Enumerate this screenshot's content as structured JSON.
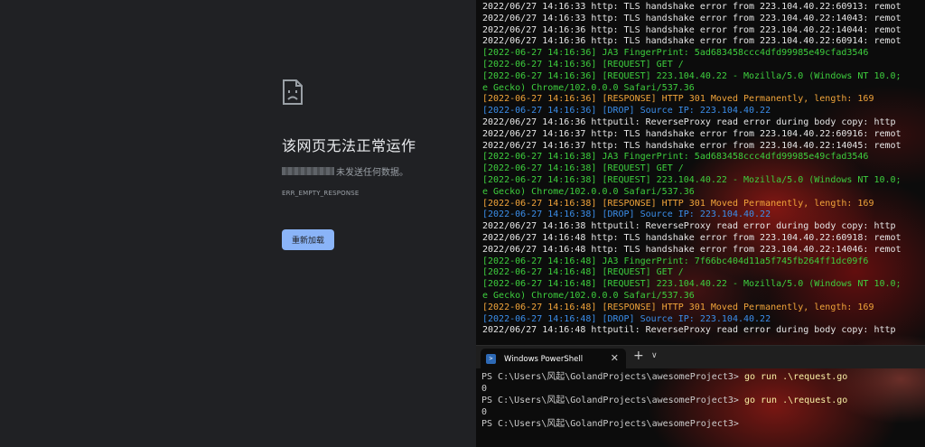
{
  "browser": {
    "error_title": "该网页无法正常运作",
    "error_desc_suffix": "未发送任何数据。",
    "error_code": "ERR_EMPTY_RESPONSE",
    "reload_label": "重新加载",
    "colors": {
      "background": "#202124",
      "button": "#8ab4f8"
    }
  },
  "terminal": {
    "log_lines": [
      {
        "color": "white",
        "text": "2022/06/27 14:16:33 http: TLS handshake error from 223.104.40.22:60913: remot"
      },
      {
        "color": "white",
        "text": "2022/06/27 14:16:33 http: TLS handshake error from 223.104.40.22:14043: remot"
      },
      {
        "color": "white",
        "text": "2022/06/27 14:16:36 http: TLS handshake error from 223.104.40.22:14044: remot"
      },
      {
        "color": "white",
        "text": "2022/06/27 14:16:36 http: TLS handshake error from 223.104.40.22:60914: remot"
      },
      {
        "color": "green",
        "text": "[2022-06-27 14:16:36] JA3 FingerPrint: 5ad683458ccc4dfd99985e49cfad3546"
      },
      {
        "color": "green",
        "text": "[2022-06-27 14:16:36] [REQUEST] GET /"
      },
      {
        "color": "green",
        "text": "[2022-06-27 14:16:36] [REQUEST] 223.104.40.22 - Mozilla/5.0 (Windows NT 10.0;"
      },
      {
        "color": "green",
        "text": "e Gecko) Chrome/102.0.0.0 Safari/537.36"
      },
      {
        "color": "orange",
        "text": "[2022-06-27 14:16:36] [RESPONSE] HTTP 301 Moved Permanently, length: 169"
      },
      {
        "color": "blue",
        "text": "[2022-06-27 14:16:36] [DROP] Source IP: 223.104.40.22"
      },
      {
        "color": "white",
        "text": "2022/06/27 14:16:36 httputil: ReverseProxy read error during body copy: http"
      },
      {
        "color": "white",
        "text": "2022/06/27 14:16:37 http: TLS handshake error from 223.104.40.22:60916: remot"
      },
      {
        "color": "white",
        "text": "2022/06/27 14:16:37 http: TLS handshake error from 223.104.40.22:14045: remot"
      },
      {
        "color": "green",
        "text": "[2022-06-27 14:16:38] JA3 FingerPrint: 5ad683458ccc4dfd99985e49cfad3546"
      },
      {
        "color": "green",
        "text": "[2022-06-27 14:16:38] [REQUEST] GET /"
      },
      {
        "color": "green",
        "text": "[2022-06-27 14:16:38] [REQUEST] 223.104.40.22 - Mozilla/5.0 (Windows NT 10.0;"
      },
      {
        "color": "green",
        "text": "e Gecko) Chrome/102.0.0.0 Safari/537.36"
      },
      {
        "color": "orange",
        "text": "[2022-06-27 14:16:38] [RESPONSE] HTTP 301 Moved Permanently, length: 169"
      },
      {
        "color": "blue",
        "text": "[2022-06-27 14:16:38] [DROP] Source IP: 223.104.40.22"
      },
      {
        "color": "white",
        "text": "2022/06/27 14:16:38 httputil: ReverseProxy read error during body copy: http"
      },
      {
        "color": "white",
        "text": "2022/06/27 14:16:48 http: TLS handshake error from 223.104.40.22:60918: remot"
      },
      {
        "color": "white",
        "text": "2022/06/27 14:16:48 http: TLS handshake error from 223.104.40.22:14046: remot"
      },
      {
        "color": "green",
        "text": "[2022-06-27 14:16:48] JA3 FingerPrint: 7f66bc404d11a5f745fb264ff1dc09f6"
      },
      {
        "color": "green",
        "text": "[2022-06-27 14:16:48] [REQUEST] GET /"
      },
      {
        "color": "green",
        "text": "[2022-06-27 14:16:48] [REQUEST] 223.104.40.22 - Mozilla/5.0 (Windows NT 10.0;"
      },
      {
        "color": "green",
        "text": "e Gecko) Chrome/102.0.0.0 Safari/537.36"
      },
      {
        "color": "orange",
        "text": "[2022-06-27 14:16:48] [RESPONSE] HTTP 301 Moved Permanently, length: 169"
      },
      {
        "color": "blue",
        "text": "[2022-06-27 14:16:48] [DROP] Source IP: 223.104.40.22"
      },
      {
        "color": "white",
        "text": "2022/06/27 14:16:48 httputil: ReverseProxy read error during body copy: http"
      }
    ],
    "tab": {
      "title": "Windows PowerShell",
      "close_glyph": "✕",
      "new_tab_glyph": "+",
      "dropdown_glyph": "∨"
    },
    "prompt": "PS C:\\Users\\风起\\GolandProjects\\awesomeProject3> ",
    "shell_lines": [
      {
        "command": "go run .\\request.go"
      },
      {
        "output": "0"
      },
      {
        "command": "go run .\\request.go"
      },
      {
        "output": "0"
      },
      {
        "command": ""
      }
    ],
    "colors": {
      "white": "#e6e6e6",
      "green": "#3ecf3e",
      "orange": "#f1a43a",
      "blue": "#3b8eea",
      "command": "#f9f1a5"
    }
  }
}
